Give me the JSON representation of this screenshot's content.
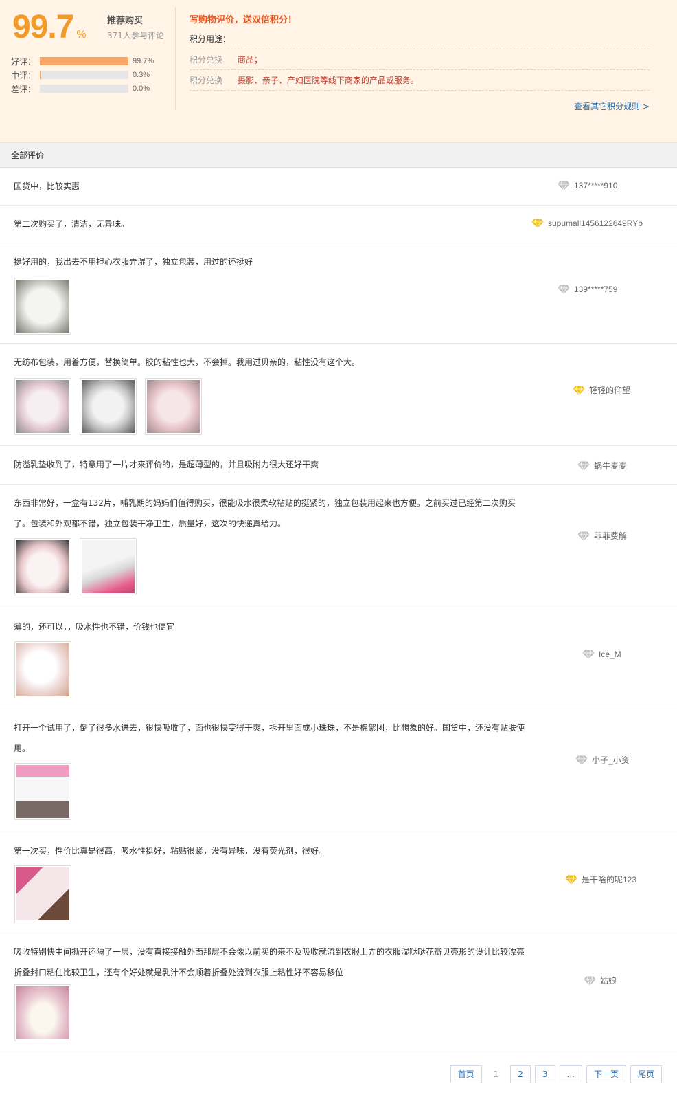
{
  "summary": {
    "rate": "99.7",
    "rate_unit": "%",
    "recommend_label": "推荐购买",
    "participants": "371人参与评论",
    "bars": [
      {
        "label": "好评：",
        "value": "99.7%",
        "fraction": 0.997
      },
      {
        "label": "中评：",
        "value": "0.3%",
        "fraction": 0.003
      },
      {
        "label": "差评：",
        "value": "0.0%",
        "fraction": 0.0
      }
    ]
  },
  "points": {
    "title": "写购物评价，送双倍积分！",
    "usage_label": "积分用途：",
    "rows": [
      {
        "key": "积分兑换",
        "value": "商品；"
      },
      {
        "key": "积分兑换",
        "value": "摄影、亲子、产妇医院等线下商家的产品或服务。"
      }
    ],
    "more_link": "查看其它积分规则 >"
  },
  "list_header": "全部评价",
  "colors": {
    "accent_orange": "#f39b2a",
    "bar_fill": "#f8a56a",
    "link_blue": "#2b6ead",
    "gem_silver": "#c9c9c9",
    "gem_gold": "#f5c518"
  },
  "reviews": [
    {
      "text": "国货中，比较实惠",
      "user": "137*****910",
      "gem": "silver",
      "images": []
    },
    {
      "text": "第二次购买了，清洁，无异味。",
      "user": "supumall1456122649RYb",
      "gem": "gold",
      "images": []
    },
    {
      "text": "挺好用的，我出去不用担心衣服弄湿了，独立包装，用过的还挺好",
      "user": "139*****759",
      "gem": "silver",
      "images": [
        "pad-photo"
      ]
    },
    {
      "text": "无纺布包装，用着方便，替换简单。胶的粘性也大，不会掉。我用过贝亲的，粘性没有这个大。",
      "user": "轻轻的仰望",
      "gem": "gold",
      "images": [
        "pad-photo",
        "pad-photo",
        "pad-photo"
      ]
    },
    {
      "text": "防溢乳垫收到了，特意用了一片才来评价的，是超薄型的，并且吸附力很大还好干爽",
      "user": "蜗牛麦麦",
      "gem": "silver",
      "images": []
    },
    {
      "text": "东西非常好，一盒有132片，哺乳期的妈妈们值得购买，很能吸水很柔软粘贴的挺紧的，独立包装用起来也方便。之前买过已经第二次购买了。包装和外观都不错，独立包装干净卫生，质量好，这次的快递真给力。",
      "user": "菲菲费解",
      "gem": "silver",
      "images": [
        "pad-photo",
        "box-photo"
      ]
    },
    {
      "text": "薄的，还可以，，吸水性也不错，价钱也便宜",
      "user": "Ice_M",
      "gem": "silver",
      "images": [
        "pad-photo"
      ]
    },
    {
      "text": "打开一个试用了，倒了很多水进去，很快吸收了，面也很快变得干爽，拆开里面成小珠珠，不是棉絮团，比想象的好。国货中，还没有贴肤使用。",
      "user": "小子_小资",
      "gem": "silver",
      "images": [
        "box-photo"
      ]
    },
    {
      "text": "第一次买，性价比真是很高，吸水性挺好，粘贴很紧，没有异味，没有荧光剂，很好。",
      "user": "是干啥的呢123",
      "gem": "gold",
      "images": [
        "box-photo"
      ]
    },
    {
      "text": "吸收特别快中间撕开还隔了一层，没有直接接触外面那层不会像以前买的来不及吸收就流到衣服上弄的衣服湿哒哒花瓣贝壳形的设计比较漂亮折叠封口粘住比较卫生，还有个好处就是乳汁不会顺着折叠处流到衣服上粘性好不容易移位",
      "user": "姑娘",
      "gem": "silver",
      "images": [
        "pad-photo"
      ]
    }
  ],
  "pagination": {
    "first": "首页",
    "pages": [
      "1",
      "2",
      "3",
      "..."
    ],
    "current": "1",
    "next": "下一页",
    "last": "尾页"
  }
}
